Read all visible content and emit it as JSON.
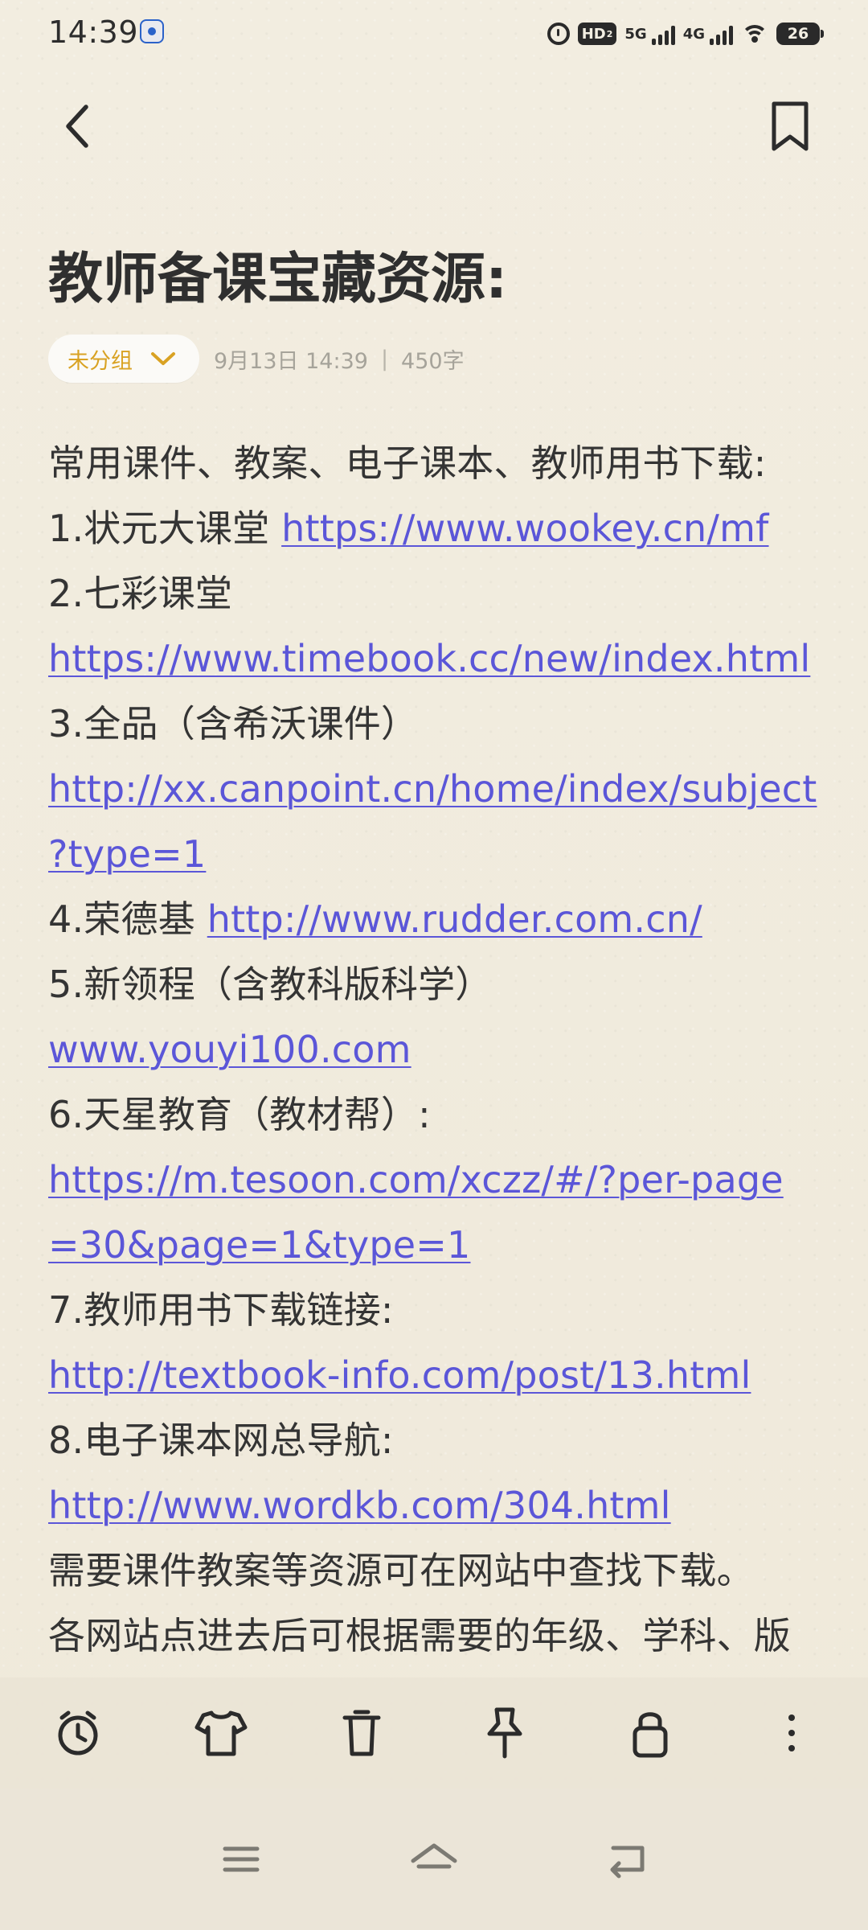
{
  "status_bar": {
    "time": "14:39",
    "hd_label": "HD",
    "hd_sub": "2",
    "network_5g": "5G",
    "network_4g": "4G",
    "battery": "26",
    "app_icon": "baidu-app-icon"
  },
  "header": {
    "back_icon": "back-icon",
    "bookmark_icon": "bookmark-icon"
  },
  "note": {
    "title": "教师备课宝藏资源:",
    "group": "未分组",
    "date_time": "9月13日 14:39",
    "separator": "|",
    "word_count": "450字",
    "lines": [
      {
        "text": "常用课件、教案、电子课本、教师用书下载:"
      },
      {
        "text": "1.状元大课堂 ",
        "link": "https://www.wookey.cn/mf"
      },
      {
        "text": "2.七彩课堂"
      },
      {
        "link": "https://www.timebook.cc/new/index.html"
      },
      {
        "text": "3.全品（含希沃课件）"
      },
      {
        "link": "http://xx.canpoint.cn/home/index/subject"
      },
      {
        "link": "?type=1"
      },
      {
        "text": "4.荣德基 ",
        "link": "http://www.rudder.com.cn/"
      },
      {
        "text": "5.新领程（含教科版科学）"
      },
      {
        "link": "www.youyi100.com"
      },
      {
        "text": "6.天星教育（教材帮）:"
      },
      {
        "link": "https://m.tesoon.com/xczz/#/?per-page"
      },
      {
        "link": "=30&page=1&type=1"
      },
      {
        "text": "7.教师用书下载链接:"
      },
      {
        "link": "http://textbook-info.com/post/13.html"
      },
      {
        "text": "8.电子课本网总导航:"
      },
      {
        "link": "http://www.wordkb.com/304.html"
      },
      {
        "text": "需要课件教案等资源可在网站中查找下载。"
      },
      {
        "text": "各网站点进去后可根据需要的年级、学科、版"
      }
    ]
  },
  "toolbar": {
    "icons": [
      "alarm-icon",
      "theme-shirt-icon",
      "trash-icon",
      "pin-icon",
      "lock-icon",
      "more-icon"
    ]
  },
  "system_nav": {
    "icons": [
      "menu-icon",
      "home-icon",
      "return-icon"
    ]
  },
  "colors": {
    "background": "#f1ecde",
    "text": "#343434",
    "link": "#5b56d8",
    "group_accent": "#d9a223",
    "meta": "#a6a39a"
  }
}
